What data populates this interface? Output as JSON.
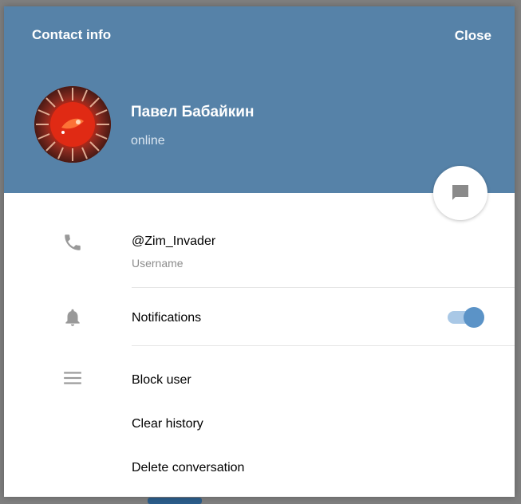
{
  "dialog": {
    "title": "Contact info",
    "close_label": "Close"
  },
  "contact": {
    "name": "Павел Бабайкин",
    "status": "online",
    "username": "@Zim_Invader",
    "username_caption": "Username"
  },
  "settings": {
    "notifications_label": "Notifications",
    "notifications_enabled": true
  },
  "actions": {
    "block_user": "Block user",
    "clear_history": "Clear history",
    "delete_conversation": "Delete conversation"
  },
  "colors": {
    "header": "#5682a8",
    "toggle_on": "#5b93c7",
    "icon_gray": "#999999"
  },
  "icons": {
    "phone": "phone-icon",
    "notifications": "bell-icon",
    "more": "menu-icon",
    "message": "message-icon"
  }
}
